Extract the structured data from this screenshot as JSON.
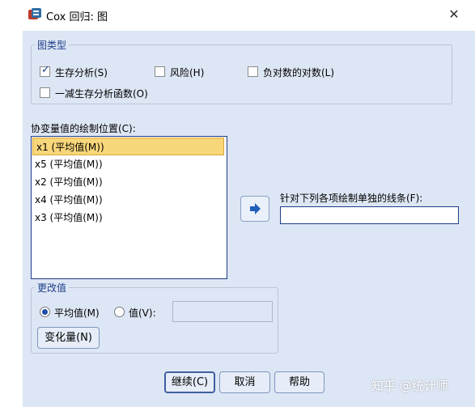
{
  "window": {
    "title": "Cox 回归: 图",
    "close_glyph": "✕",
    "icon": "spss-dialog-icon"
  },
  "chart_type": {
    "legend": "图类型",
    "options": [
      {
        "label": "生存分析(S)",
        "checked": true
      },
      {
        "label": "风险(H)",
        "checked": false
      },
      {
        "label": "负对数的对数(L)",
        "checked": false
      },
      {
        "label": "一减生存分析函数(O)",
        "checked": false
      }
    ]
  },
  "covariates": {
    "label": "协变量值的绘制位置(C):",
    "items": [
      "x1 (平均值(M))",
      "x5 (平均值(M))",
      "x2 (平均值(M))",
      "x4 (平均值(M))",
      "x3 (平均值(M))"
    ],
    "selected_index": 0
  },
  "separate_lines": {
    "label": "针对下列各项绘制单独的线条(F):",
    "value": ""
  },
  "move_button": {
    "icon": "right-arrow-icon"
  },
  "change_value": {
    "legend": "更改值",
    "mean_label": "平均值(M)",
    "value_label": "值(V):",
    "value_input": "",
    "selected": "mean",
    "change_button": "变化量(N)"
  },
  "buttons": {
    "continue": "继续(C)",
    "cancel": "取消",
    "help": "帮助"
  },
  "watermark": "知乎 @统计师",
  "colors": {
    "panel_bg": "#dde6f4",
    "legend_text": "#1e3f8a",
    "selection": "#f8d67a",
    "border_accent": "#1f3c88"
  }
}
